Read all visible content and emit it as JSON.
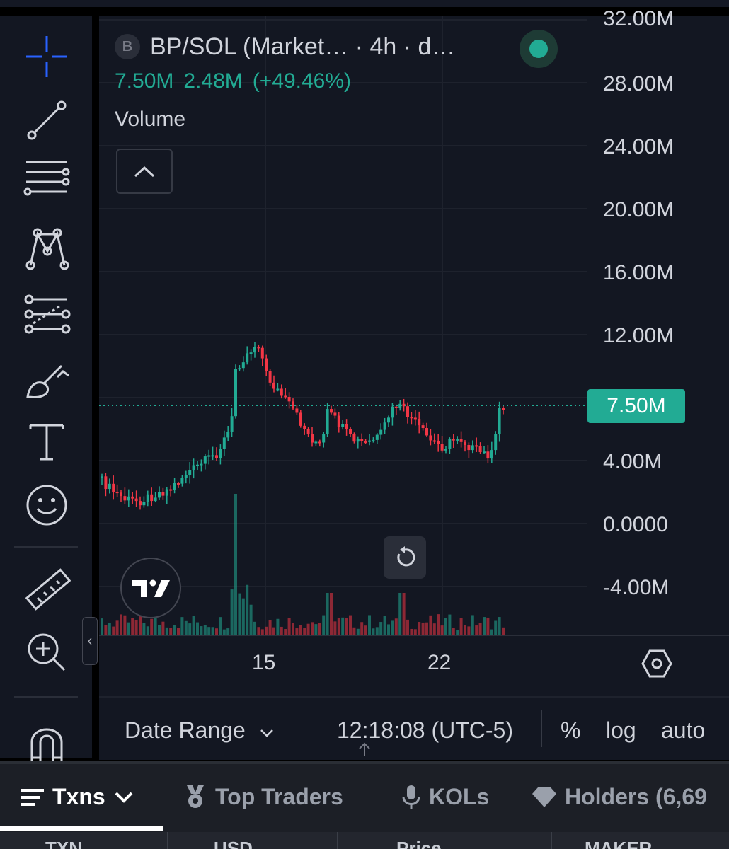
{
  "chart": {
    "title": "BP/SOL (Market… · 4h · d…",
    "symbol_badge": "B",
    "last_value": "7.50M",
    "change_value": "2.48M",
    "change_pct": "(+49.46%)",
    "indicator_label": "Volume",
    "price_axis": [
      "32.00M",
      "28.00M",
      "24.00M",
      "20.00M",
      "16.00M",
      "12.00M",
      "4.00M",
      "0.0000",
      "-4.00M"
    ],
    "time_axis": [
      "15",
      "22"
    ],
    "colors": {
      "up": "#22ab94",
      "down": "#f23645",
      "bg": "#131722",
      "grid": "#1e222d"
    }
  },
  "toolbar": {
    "tools": [
      "crosshair-icon",
      "trend-line-icon",
      "parallel-channel-icon",
      "pattern-icon",
      "fib-retracement-icon",
      "brush-icon",
      "text-icon",
      "emoji-icon",
      "ruler-icon",
      "zoom-in-icon",
      "magnet-icon"
    ]
  },
  "bottom_bar": {
    "date_range": "Date Range",
    "clock": "12:18:08 (UTC-5)",
    "percent": "%",
    "log": "log",
    "auto": "auto"
  },
  "tabs": [
    {
      "label": "Txns",
      "icon": "menu-icon"
    },
    {
      "label": "Top Traders",
      "icon": "medal-icon"
    },
    {
      "label": "KOLs",
      "icon": "microphone-icon"
    },
    {
      "label": "Holders (6,69",
      "icon": "diamond-icon"
    }
  ],
  "table_headers": [
    "TXN",
    "USD",
    "Price",
    "MAKER"
  ]
}
